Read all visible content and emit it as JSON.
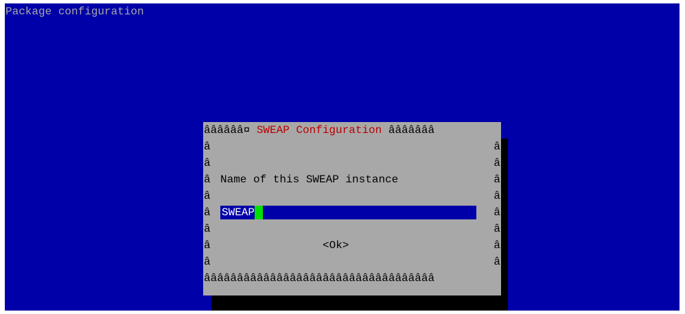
{
  "screen": {
    "title": "Package configuration"
  },
  "dialog": {
    "border_top_left": "ââââââ¤ ",
    "title": "SWEAP Configuration",
    "border_top_right": " âââââââ",
    "border_side": "â",
    "border_bottom": "âââââââââââââââââââââââââââââââââââ",
    "prompt": "Name of this SWEAP instance",
    "input_value": "SWEAP",
    "ok_label": "<Ok>"
  },
  "colors": {
    "background": "#0000a8",
    "dialog": "#a8a8a8",
    "title": "#b80000",
    "cursor": "#00e000"
  }
}
